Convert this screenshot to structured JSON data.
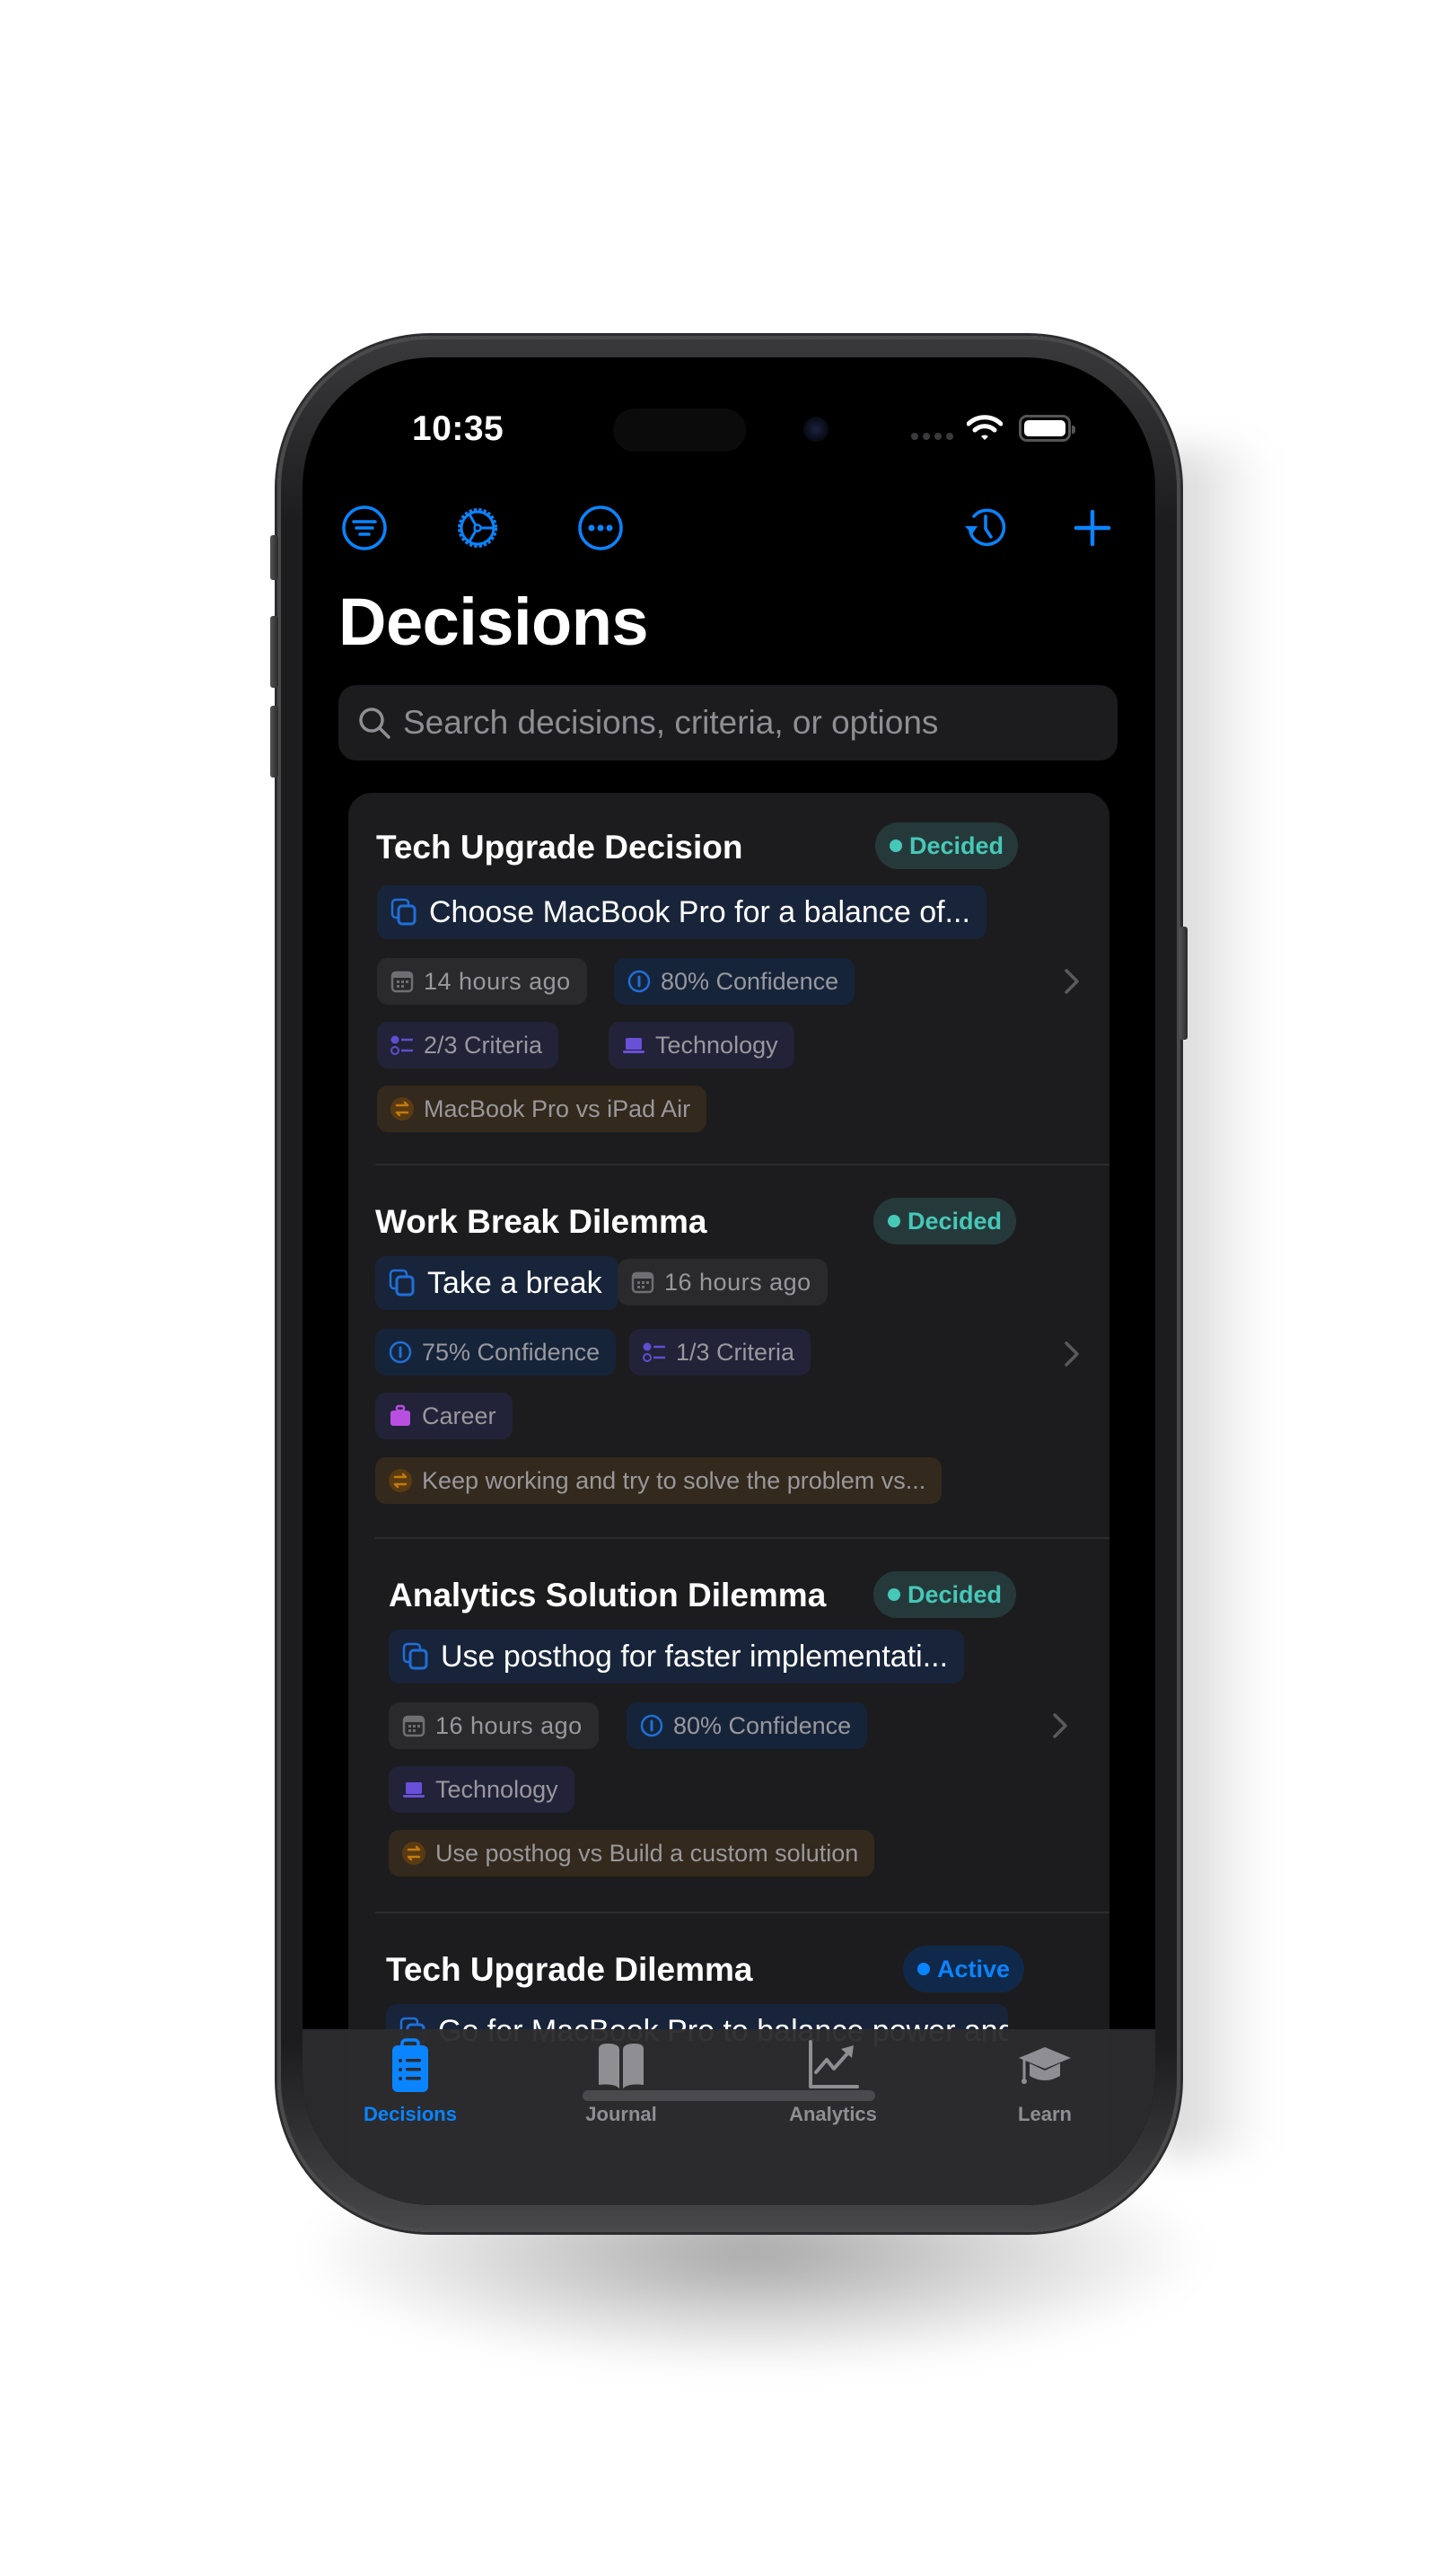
{
  "status_bar": {
    "time": "10:35"
  },
  "toolbar": {
    "left": [
      {
        "name": "filter-icon",
        "label": "Filter"
      },
      {
        "name": "settings-gear-icon",
        "label": "Settings"
      },
      {
        "name": "more-ellipsis-icon",
        "label": "More"
      }
    ],
    "right": [
      {
        "name": "history-icon",
        "label": "History"
      },
      {
        "name": "add-plus-icon",
        "label": "New decision"
      }
    ]
  },
  "header": {
    "title": "Decisions"
  },
  "search": {
    "placeholder": "Search decisions, criteria, or options",
    "value": ""
  },
  "colors": {
    "accent": "#0a84ff",
    "decided": "#46c8b8",
    "active": "#0a84ff",
    "background": "#000000",
    "card": "#1c1c1e"
  },
  "decisions": [
    {
      "title": "Tech Upgrade Decision",
      "status": "Decided",
      "choice": "Choose MacBook Pro for a balance of...",
      "time": "14 hours ago",
      "confidence": "80% Confidence",
      "criteria": "2/3 Criteria",
      "category": "Technology",
      "options": "MacBook Pro vs iPad Air"
    },
    {
      "title": "Work Break Dilemma",
      "status": "Decided",
      "choice": "Take a break",
      "time": "16 hours ago",
      "confidence": "75% Confidence",
      "criteria": "1/3 Criteria",
      "category": "Career",
      "options": "Keep working and try to solve the problem  vs..."
    },
    {
      "title": "Analytics Solution Dilemma",
      "status": "Decided",
      "choice": "Use posthog for faster implementati...",
      "time": "16 hours ago",
      "confidence": "80% Confidence",
      "category": "Technology",
      "options": "Use posthog vs Build a custom solution"
    },
    {
      "title": "Tech Upgrade Dilemma",
      "status": "Active",
      "choice": "Go for MacBook Pro to balance power and..."
    }
  ],
  "tabbar": {
    "selected": "Decisions",
    "tabs": [
      {
        "label": "Decisions",
        "icon": "clipboard-list-icon"
      },
      {
        "label": "Journal",
        "icon": "book-icon"
      },
      {
        "label": "Analytics",
        "icon": "chart-line-icon"
      },
      {
        "label": "Learn",
        "icon": "graduation-cap-icon"
      }
    ]
  }
}
